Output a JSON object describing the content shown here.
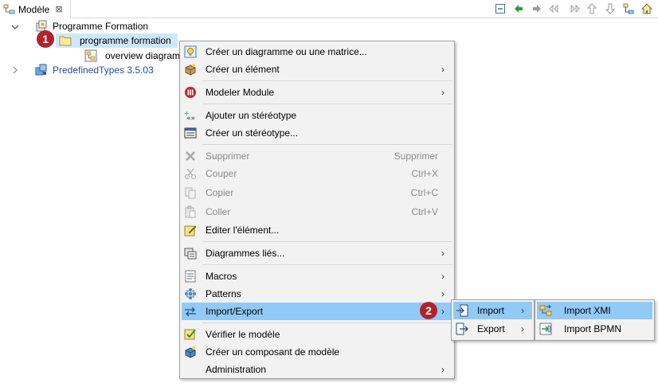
{
  "view_tab": {
    "title": "Modèle",
    "close_glyph": "⊠"
  },
  "toolbar": [
    "collapse-all-icon",
    "back-icon",
    "forward-icon",
    "link-back-icon",
    "link-forward-icon",
    "up-icon",
    "down-icon",
    "hierarchy-icon",
    "home-icon"
  ],
  "tree": {
    "root": "Programme Formation",
    "selected": "programme formation",
    "child": "overview diagram",
    "predefined": "PredefinedTypes 3.5.03"
  },
  "badges": {
    "one": "1",
    "two": "2"
  },
  "context_menu": {
    "items": [
      {
        "label": "Créer un diagramme ou une matrice...",
        "icon": "wizard-bulb-icon"
      },
      {
        "label": "Créer un élément",
        "icon": "create-element-icon",
        "submenu": true
      },
      {
        "label": "Modeler Module",
        "icon": "modeler-module-icon",
        "submenu": true
      },
      {
        "label": "Ajouter un stéréotype",
        "icon": "add-stereotype-icon"
      },
      {
        "label": "Créer un stéréotype...",
        "icon": "create-stereotype-icon"
      },
      {
        "label": "Supprimer",
        "shortcut": "Supprimer",
        "icon": "delete-icon",
        "disabled": true
      },
      {
        "label": "Couper",
        "shortcut": "Ctrl+X",
        "icon": "cut-icon",
        "disabled": true
      },
      {
        "label": "Copier",
        "shortcut": "Ctrl+C",
        "icon": "copy-icon",
        "disabled": true
      },
      {
        "label": "Coller",
        "shortcut": "Ctrl+V",
        "icon": "paste-icon",
        "disabled": true
      },
      {
        "label": "Editer l'élément...",
        "icon": "edit-element-icon"
      },
      {
        "label": "Diagrammes liés...",
        "icon": "linked-diagrams-icon",
        "submenu": true
      },
      {
        "label": "Macros",
        "icon": "macros-icon",
        "submenu": true
      },
      {
        "label": "Patterns",
        "icon": "patterns-icon",
        "submenu": true
      },
      {
        "label": "Import/Export",
        "icon": "import-export-icon",
        "submenu": true,
        "active": true
      },
      {
        "label": "Vérifier le modèle",
        "icon": "check-model-icon"
      },
      {
        "label": "Créer un composant de modèle",
        "icon": "model-component-icon"
      },
      {
        "label": "Administration",
        "submenu": true
      }
    ]
  },
  "import_export_menu": {
    "items": [
      {
        "label": "Import",
        "icon": "import-icon",
        "submenu": true,
        "active": true
      },
      {
        "label": "Export",
        "icon": "export-icon",
        "submenu": true
      }
    ]
  },
  "import_menu": {
    "items": [
      {
        "label": "Import XMI",
        "icon": "import-xmi-icon",
        "active": true
      },
      {
        "label": "Import BPMN",
        "icon": "import-bpmn-icon"
      }
    ]
  },
  "colors": {
    "selection": "#cce8ff",
    "menu_highlight": "#91c9f7",
    "badge": "#b3212b",
    "link_blue": "#0000c0"
  }
}
